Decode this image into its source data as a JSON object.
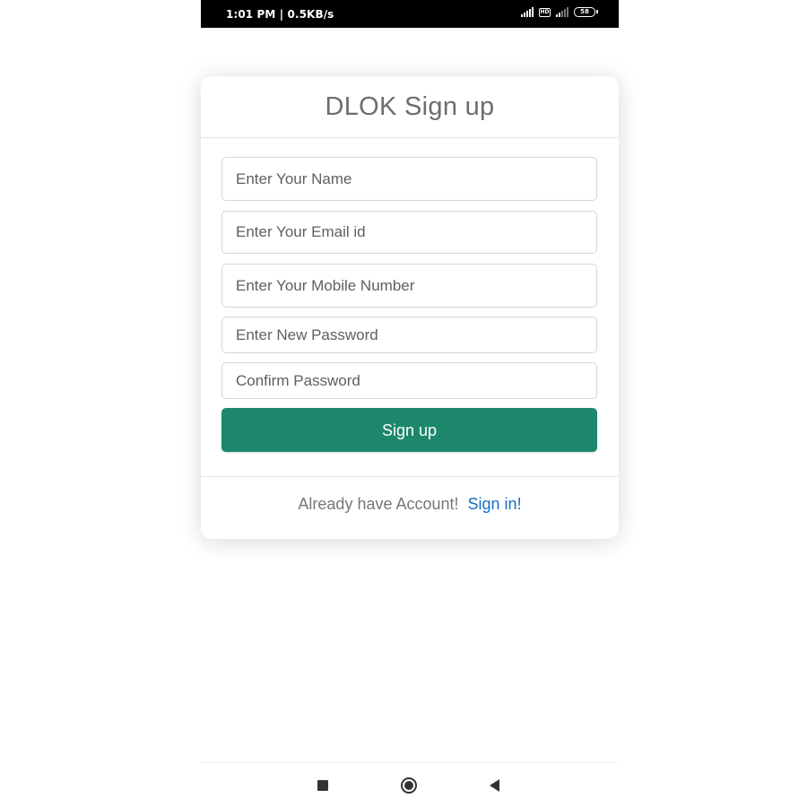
{
  "status_bar": {
    "time_speed": "1:01 PM | 0.5KB/s",
    "battery_level": "58",
    "hd_label": "HD",
    "icons": [
      "signal-icon",
      "hd-icon",
      "wifi-signal-icon",
      "battery-icon"
    ]
  },
  "form": {
    "title": "DLOK Sign up",
    "fields": [
      {
        "name": "name",
        "placeholder": "Enter Your Name",
        "value": ""
      },
      {
        "name": "email",
        "placeholder": "Enter Your Email id",
        "value": ""
      },
      {
        "name": "mobile",
        "placeholder": "Enter Your Mobile Number",
        "value": ""
      },
      {
        "name": "new_password",
        "placeholder": "Enter New Password",
        "value": ""
      },
      {
        "name": "confirm_password",
        "placeholder": "Confirm Password",
        "value": ""
      }
    ],
    "submit_label": "Sign up",
    "footer_text": "Already have Account!",
    "footer_link": "Sign in!"
  },
  "colors": {
    "accent": "#1c876b",
    "link": "#1a6fc4",
    "status_bar_bg": "#000000"
  },
  "nav_bar": {
    "icons": [
      "recent-apps-icon",
      "home-icon",
      "back-icon"
    ]
  }
}
